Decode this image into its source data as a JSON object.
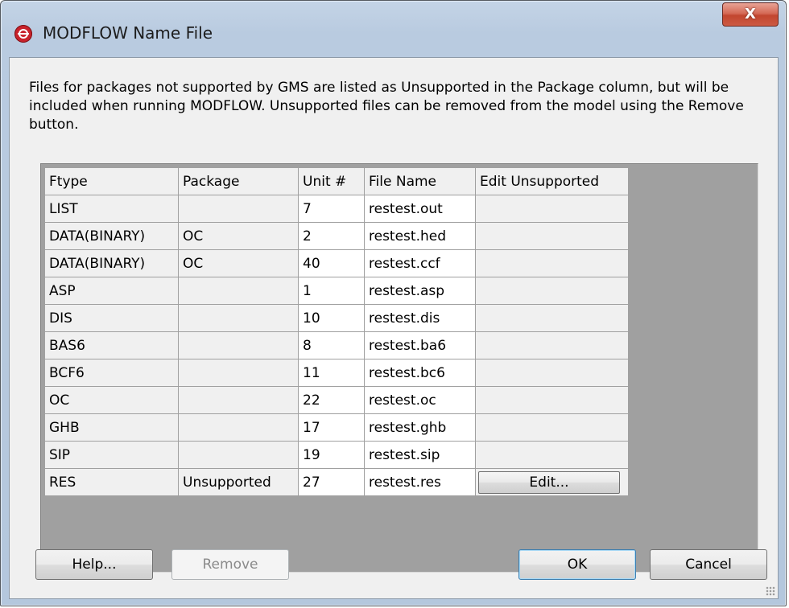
{
  "window": {
    "title": "MODFLOW Name File",
    "close_label": "X"
  },
  "description": "Files for packages not supported by GMS are listed as Unsupported in the Package column, but will be included when running MODFLOW.  Unsupported files can be removed from the model using the Remove button.",
  "table": {
    "columns": [
      "Ftype",
      "Package",
      "Unit #",
      "File Name",
      "Edit Unsupported"
    ],
    "rows": [
      {
        "ftype": "LIST",
        "package": "",
        "unit": "7",
        "file": "restest.out",
        "edit": ""
      },
      {
        "ftype": "DATA(BINARY)",
        "package": "OC",
        "unit": "2",
        "file": "restest.hed",
        "edit": ""
      },
      {
        "ftype": "DATA(BINARY)",
        "package": "OC",
        "unit": "40",
        "file": "restest.ccf",
        "edit": ""
      },
      {
        "ftype": "ASP",
        "package": "",
        "unit": "1",
        "file": "restest.asp",
        "edit": ""
      },
      {
        "ftype": "DIS",
        "package": "",
        "unit": "10",
        "file": "restest.dis",
        "edit": ""
      },
      {
        "ftype": "BAS6",
        "package": "",
        "unit": "8",
        "file": "restest.ba6",
        "edit": ""
      },
      {
        "ftype": "BCF6",
        "package": "",
        "unit": "11",
        "file": "restest.bc6",
        "edit": ""
      },
      {
        "ftype": "OC",
        "package": "",
        "unit": "22",
        "file": "restest.oc",
        "edit": ""
      },
      {
        "ftype": "GHB",
        "package": "",
        "unit": "17",
        "file": "restest.ghb",
        "edit": ""
      },
      {
        "ftype": "SIP",
        "package": "",
        "unit": "19",
        "file": "restest.sip",
        "edit": ""
      },
      {
        "ftype": "RES",
        "package": "Unsupported",
        "unit": "27",
        "file": "restest.res",
        "edit": "Edit..."
      }
    ]
  },
  "buttons": {
    "help": "Help...",
    "remove": "Remove",
    "ok": "OK",
    "cancel": "Cancel"
  },
  "colors": {
    "close_button": "#c9503a",
    "app_icon": "#c8222c",
    "grid_background": "#a0a0a0",
    "default_button_border": "#3c7fb1"
  }
}
